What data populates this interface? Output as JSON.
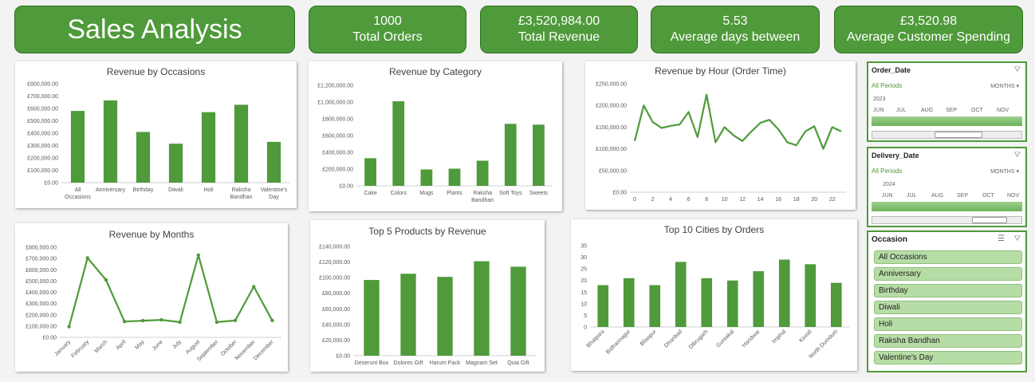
{
  "dashboard_title": "Sales Analysis",
  "kpis": [
    {
      "value": "1000",
      "label": "Total Orders"
    },
    {
      "value": "£3,520,984.00",
      "label": "Total Revenue"
    },
    {
      "value": "5.53",
      "label": "Average days between"
    },
    {
      "value": "£3,520.98",
      "label": "Average Customer Spending"
    }
  ],
  "colors": {
    "accent": "#4f9a3a",
    "bar": "#4f9a3a"
  },
  "chart_data": [
    {
      "id": "occasions",
      "type": "bar",
      "title": "Revenue by Occasions",
      "categories": [
        "All Occasions",
        "Anniversary",
        "Birthday",
        "Diwali",
        "Holi",
        "Raksha Bandhan",
        "Valentine's Day"
      ],
      "values": [
        580000,
        665000,
        410000,
        315000,
        570000,
        630000,
        330000
      ],
      "yticks": [
        "£0.00",
        "£100,000.00",
        "£200,000.00",
        "£300,000.00",
        "£400,000.00",
        "£500,000.00",
        "£600,000.00",
        "£700,000.00",
        "£800,000.00"
      ],
      "ylim": [
        0,
        800000
      ]
    },
    {
      "id": "category",
      "type": "bar",
      "title": "Revenue by Category",
      "categories": [
        "Cake",
        "Colors",
        "Mugs",
        "Plants",
        "Raksha Bandhan",
        "Soft Toys",
        "Sweets"
      ],
      "values": [
        330000,
        1010000,
        195000,
        205000,
        300000,
        740000,
        730000
      ],
      "yticks": [
        "£0.00",
        "£200,000.00",
        "£400,000.00",
        "£600,000.00",
        "£800,000.00",
        "£1,000,000.00",
        "£1,200,000.00"
      ],
      "ylim": [
        0,
        1200000
      ]
    },
    {
      "id": "hour",
      "type": "line",
      "title": "Revenue by Hour (Order Time)",
      "x": [
        0,
        1,
        2,
        3,
        4,
        5,
        6,
        7,
        8,
        9,
        10,
        11,
        12,
        13,
        14,
        15,
        16,
        17,
        18,
        19,
        20,
        21,
        22,
        23
      ],
      "values": [
        118000,
        200000,
        162000,
        148000,
        153000,
        156000,
        185000,
        127000,
        225000,
        115000,
        150000,
        131000,
        118000,
        140000,
        160000,
        167000,
        145000,
        115000,
        108000,
        140000,
        152000,
        100000,
        150000,
        140000
      ],
      "xticks": [
        "0",
        "2",
        "4",
        "6",
        "8",
        "10",
        "12",
        "14",
        "16",
        "18",
        "20",
        "22"
      ],
      "yticks": [
        "£0.00",
        "£50,000.00",
        "£100,000.00",
        "£150,000.00",
        "£200,000.00",
        "£250,000.00"
      ],
      "ylim": [
        0,
        250000
      ]
    },
    {
      "id": "months",
      "type": "line",
      "title": "Revenue by Months",
      "categories": [
        "January",
        "February",
        "March",
        "April",
        "May",
        "June",
        "July",
        "August",
        "September",
        "October",
        "November",
        "December"
      ],
      "values": [
        95000,
        705000,
        510000,
        140000,
        148000,
        155000,
        135000,
        730000,
        135000,
        150000,
        450000,
        150000
      ],
      "yticks": [
        "£0.00",
        "£100,000.00",
        "£200,000.00",
        "£300,000.00",
        "£400,000.00",
        "£500,000.00",
        "£600,000.00",
        "£700,000.00",
        "£800,000.00"
      ],
      "ylim": [
        0,
        800000
      ]
    },
    {
      "id": "products",
      "type": "bar",
      "title": "Top 5 Products by Revenue",
      "categories": [
        "Deserunt Box",
        "Dolores Gift",
        "Harum Pack",
        "Magnam Set",
        "Quia Gift"
      ],
      "values": [
        97000,
        105000,
        101000,
        121000,
        114000
      ],
      "yticks": [
        "£0.00",
        "£20,000.00",
        "£40,000.00",
        "£60,000.00",
        "£80,000.00",
        "£100,000.00",
        "£120,000.00",
        "£140,000.00"
      ],
      "ylim": [
        0,
        140000
      ]
    },
    {
      "id": "cities",
      "type": "bar",
      "title": "Top 10 Cities by Orders",
      "categories": [
        "Bhatpara",
        "Bidhannagar",
        "Bilaspur",
        "Dhanbad",
        "Dibrugarh",
        "Guntakal",
        "Haridwar",
        "Imphal",
        "Kavali",
        "North Dumdum"
      ],
      "values": [
        18,
        21,
        18,
        28,
        21,
        20,
        24,
        29,
        27,
        19
      ],
      "yticks": [
        "0",
        "5",
        "10",
        "15",
        "20",
        "25",
        "30",
        "35"
      ],
      "ylim": [
        0,
        35
      ]
    }
  ],
  "slicers": {
    "order_date": {
      "title": "Order_Date",
      "period": "All Periods",
      "unit": "MONTHS",
      "year": "2023",
      "months": [
        "JUN",
        "JUL",
        "AUG",
        "SEP",
        "OCT",
        "NOV"
      ]
    },
    "delivery_date": {
      "title": "Delivery_Date",
      "period": "All Periods",
      "unit": "MONTHS",
      "year": "2024",
      "months": [
        "JUN",
        "JUL",
        "AUG",
        "SEP",
        "OCT",
        "NOV"
      ]
    },
    "occasion": {
      "title": "Occasion",
      "items": [
        "All Occasions",
        "Anniversary",
        "Birthday",
        "Diwali",
        "Holi",
        "Raksha Bandhan",
        "Valentine's Day"
      ]
    }
  }
}
